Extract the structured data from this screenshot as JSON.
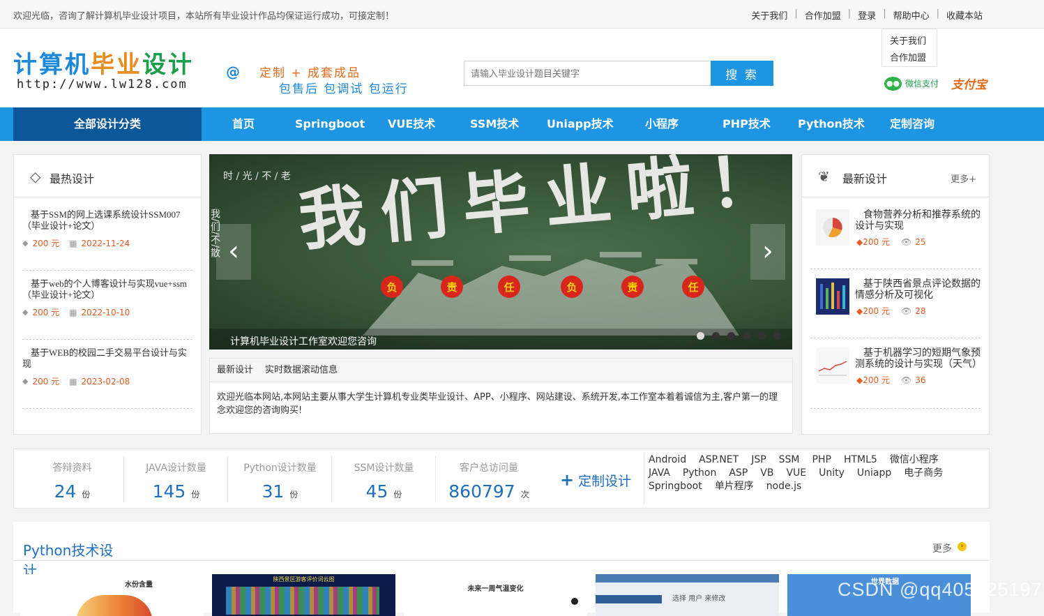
{
  "topbar": {
    "welcome": "欢迎光临，咨询了解计算机毕业设计项目，本站所有毕业设计作品均保证运行成功，可接定制！",
    "links": [
      "关于我们",
      "合作加盟",
      "登录",
      "帮助中心",
      "收藏本站"
    ],
    "dropdown": [
      "关于我们",
      "合作加盟"
    ]
  },
  "header": {
    "logo_part1": "计算机",
    "logo_part2": "毕业",
    "logo_part3": "设计",
    "url": "http://www.lw128.com",
    "slogan_at": "@",
    "slogan_line1": "定制 + 成套成品",
    "slogan_line2": "包售后 包调试 包运行",
    "search_placeholder": "请输入毕业设计题目关键字",
    "search_button": "搜 索",
    "wechat_pay": "微信支付",
    "alipay": "支付宝"
  },
  "nav": {
    "all_categories": "全部设计分类",
    "items": [
      "首页",
      "Springboot",
      "VUE技术",
      "SSM技术",
      "Uniapp技术",
      "小程序",
      "PHP技术",
      "Python技术",
      "定制咨询"
    ]
  },
  "hot": {
    "title": "最热设计",
    "items": [
      {
        "title": "基于SSM的网上选课系统设计SSM007（毕业设计+论文）",
        "price": "200 元",
        "date": "2022-11-24"
      },
      {
        "title": "基于web的个人博客设计与实现vue+ssm（毕业设计+论文）",
        "price": "200 元",
        "date": "2022-10-10"
      },
      {
        "title": "基于WEB的校园二手交易平台设计与实现",
        "price": "200 元",
        "date": "2023-02-08"
      }
    ]
  },
  "banner": {
    "caption": "计算机毕业设计工作室欢迎您咨询",
    "top_text": "时 / 光 / 不 / 老",
    "side_text": "我/们/不/散",
    "headline": "我们毕业啦！",
    "stars": [
      "负",
      "责",
      "任",
      "负",
      "责",
      "任"
    ],
    "prev": "‹",
    "next": "›"
  },
  "news": {
    "tabs": [
      "最新设计",
      "实时数据滚动信息"
    ],
    "body": "欢迎光临本网站,本网站主要从事大学生计算机专业类毕业设计、APP、小程序、网站建设、系统开发,本工作室本着着诚信为主,客户第一的理念欢迎您的咨询购买!"
  },
  "latest": {
    "title": "最新设计",
    "more": "更多+",
    "items": [
      {
        "title": "食物营养分析和推荐系统的设计与实现",
        "price": "200 元",
        "views": "25"
      },
      {
        "title": "基于陕西省景点评论数据的情感分析及可视化",
        "price": "200 元",
        "views": "28"
      },
      {
        "title": "基于机器学习的短期气象预测系统的设计与实现（天气）",
        "price": "200 元",
        "views": "36"
      }
    ]
  },
  "stats": [
    {
      "label": "答辩资料",
      "value": "24",
      "unit": "份"
    },
    {
      "label": "JAVA设计数量",
      "value": "145",
      "unit": "份"
    },
    {
      "label": "Python设计数量",
      "value": "31",
      "unit": "份"
    },
    {
      "label": "SSM设计数量",
      "value": "45",
      "unit": "份"
    },
    {
      "label": "客户总访问量",
      "value": "860797",
      "unit": "次"
    }
  ],
  "custom_design": "定制设计",
  "tags": [
    "Android",
    "ASP.NET",
    "JSP",
    "SSM",
    "PHP",
    "HTML5",
    "微信小程序",
    "JAVA",
    "Python",
    "ASP",
    "VB",
    "VUE",
    "Unity",
    "Uniapp",
    "电子商务",
    "Springboot",
    "单片程序",
    "node.js"
  ],
  "python_section": {
    "title": "Python技术设计",
    "more": "更多",
    "thumbs": [
      "水份含量",
      "陕西景区游客评价词云图",
      "未来一周气温变化",
      "选择 用户 来修改",
      "世界数据"
    ]
  },
  "watermark": "CSDN @qq405425197",
  "colors": {
    "primary": "#1e95e2",
    "nav_dark": "#0c5799",
    "price": "#e85b23",
    "logo_orange": "#e98a1c",
    "logo_green": "#1a9e4a"
  }
}
